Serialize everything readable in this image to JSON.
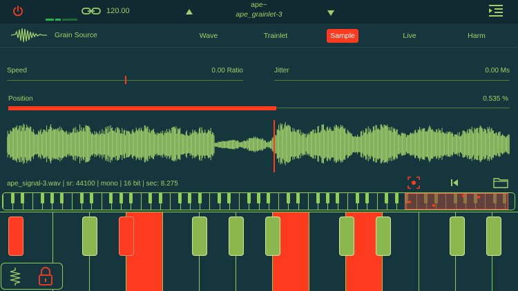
{
  "header": {
    "bpm": "120.00",
    "app_title": "ape~",
    "preset_name": "ape_grainlet-3"
  },
  "source": {
    "label": "Grain Source"
  },
  "tabs": [
    {
      "label": "Wave",
      "active": false
    },
    {
      "label": "Trainlet",
      "active": false
    },
    {
      "label": "Sample",
      "active": true
    },
    {
      "label": "Live",
      "active": false
    },
    {
      "label": "Harm",
      "active": false
    }
  ],
  "params": {
    "speed": {
      "label": "Speed",
      "value": "0.00 Ratio",
      "level": 0.5
    },
    "jitter": {
      "label": "Jitter",
      "value": "0.00 Ms"
    },
    "position": {
      "label": "Position",
      "value": "0.535 %",
      "level": 0.535
    }
  },
  "file_info": "ape_signal-3.wav | sr: 44100 | mono | 16 bit | sec: 8.275",
  "keyboard": {
    "active_white_keys": [
      3,
      7,
      9
    ],
    "active_black_keys": [
      0,
      2
    ]
  },
  "colors": {
    "accent": "#ff3b1f",
    "green": "#9fd06a",
    "background": "#16363d"
  }
}
